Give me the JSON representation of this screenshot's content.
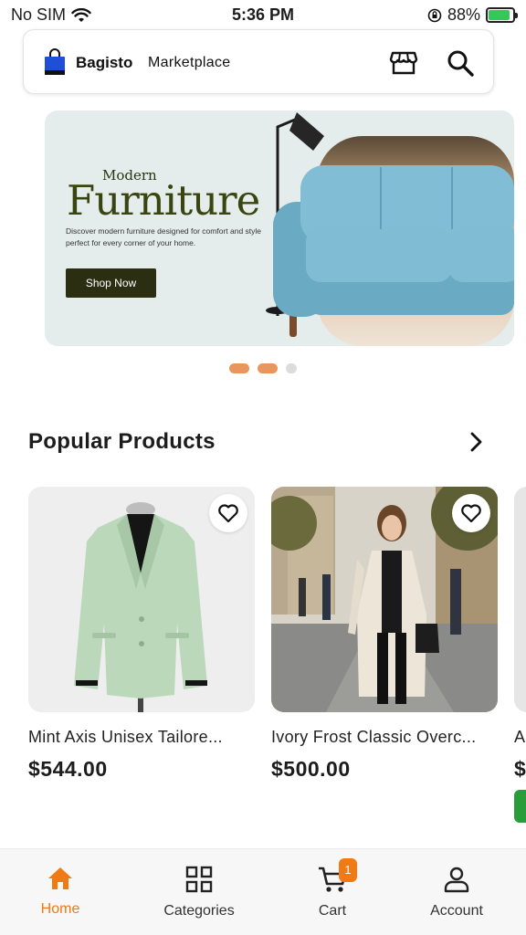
{
  "status_bar": {
    "carrier": "No SIM",
    "time": "5:36 PM",
    "battery": "88%",
    "battery_level": 0.88
  },
  "header": {
    "brand": "Bagisto",
    "brand_suffix": "Marketplace",
    "logo_color": "#1f4fd8"
  },
  "banner": {
    "subtitle": "Modern",
    "title": "Furniture",
    "description": "Discover modern furniture designed for comfort and style perfect for every corner of your home.",
    "cta_label": "Shop Now",
    "pagination": {
      "count": 3,
      "active": [
        0,
        1
      ]
    }
  },
  "section": {
    "title": "Popular Products"
  },
  "products": [
    {
      "name": "Mint Axis Unisex Tailore...",
      "price": "$544.00"
    },
    {
      "name": "Ivory Frost Classic Overc...",
      "price": "$500.00"
    },
    {
      "name": "A",
      "price": "$"
    }
  ],
  "bottom_nav": {
    "items": [
      {
        "label": "Home",
        "icon": "home-icon",
        "active": true
      },
      {
        "label": "Categories",
        "icon": "grid-icon",
        "active": false
      },
      {
        "label": "Cart",
        "icon": "cart-icon",
        "active": false,
        "badge": "1"
      },
      {
        "label": "Account",
        "icon": "person-icon",
        "active": false
      }
    ]
  },
  "colors": {
    "accent": "#f07a14",
    "banner_bg": "#e5ecec",
    "banner_button": "#2b2e10",
    "sofa": "#77b6cf"
  }
}
